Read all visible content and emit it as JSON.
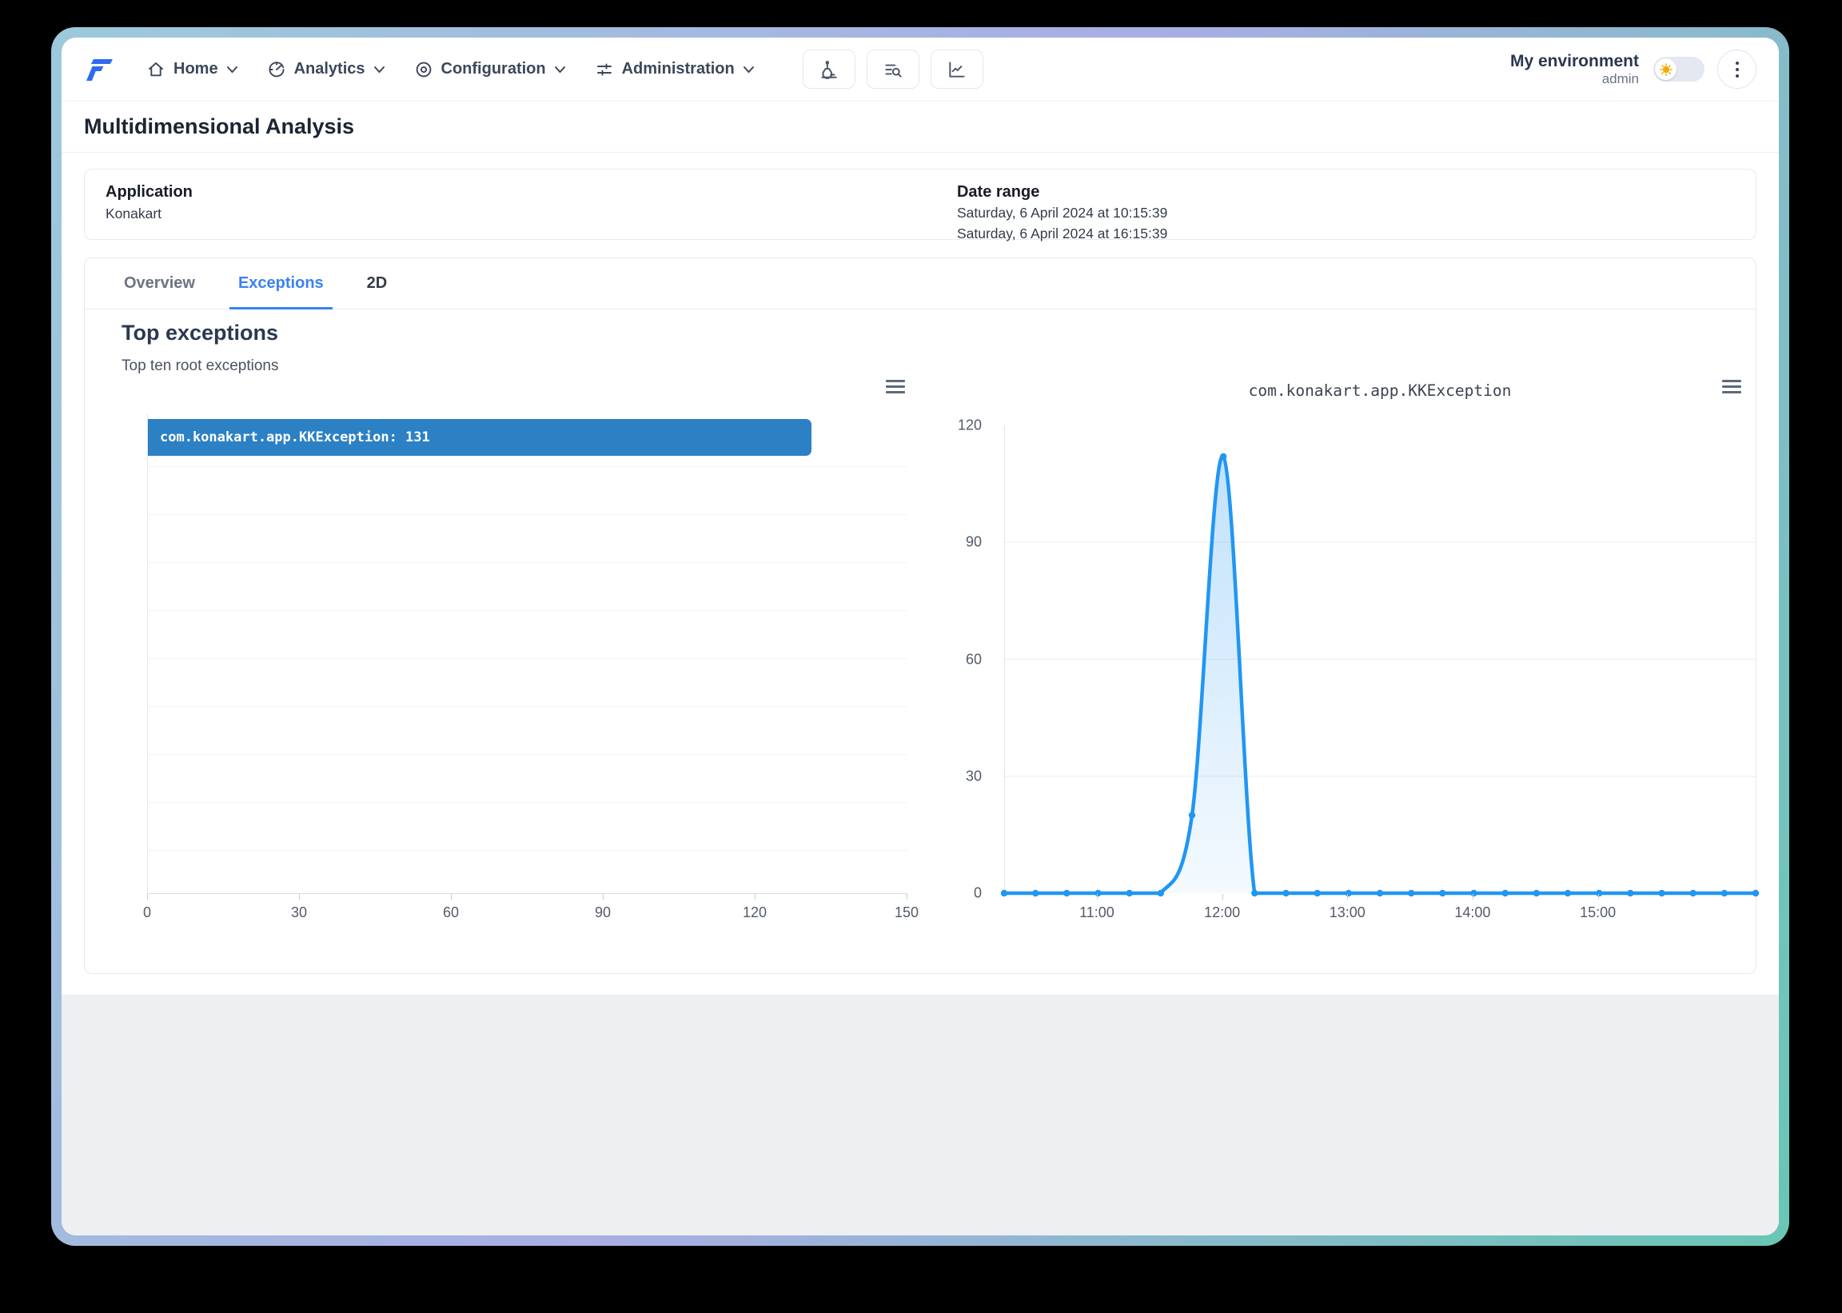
{
  "theme": {
    "accent": "#3b82f6",
    "window_border_top_left": "#9cc9db",
    "window_border_top_right": "#a9aee3",
    "window_border_bottom": "#69c6b5"
  },
  "nav": {
    "items": [
      {
        "label": "Home",
        "icon": "home-icon"
      },
      {
        "label": "Analytics",
        "icon": "analytics-icon"
      },
      {
        "label": "Configuration",
        "icon": "configuration-icon"
      },
      {
        "label": "Administration",
        "icon": "administration-icon"
      }
    ],
    "tools": [
      {
        "icon": "microscope-icon"
      },
      {
        "icon": "list-search-icon"
      },
      {
        "icon": "chart-line-icon"
      }
    ]
  },
  "environment": {
    "name": "My environment",
    "user": "admin"
  },
  "page": {
    "title": "Multidimensional Analysis",
    "filters": {
      "application_label": "Application",
      "application_value": "Konakart",
      "date_range_label": "Date range",
      "date_from": "Saturday, 6 April 2024 at 10:15:39",
      "date_to": "Saturday, 6 April 2024 at 16:15:39"
    },
    "tabs": [
      {
        "label": "Overview"
      },
      {
        "label": "Exceptions"
      },
      {
        "label": "2D"
      }
    ],
    "active_tab": "Exceptions"
  },
  "section": {
    "title": "Top exceptions",
    "subtitle": "Top ten root exceptions"
  },
  "chart_data": [
    {
      "type": "bar",
      "orientation": "horizontal",
      "title": "Top exceptions",
      "categories": [
        "com.konakart.app.KKException"
      ],
      "values": [
        131
      ],
      "bar_label": "com.konakart.app.KKException: 131",
      "xlim": [
        0,
        150
      ],
      "xticks": [
        0,
        30,
        60,
        90,
        120,
        150
      ],
      "rows": 10,
      "bar_color": "#2c80c4",
      "grid": true
    },
    {
      "type": "area",
      "title": "com.konakart.app.KKException",
      "x_start": "10:15:39",
      "x_end": "16:15:39",
      "duration_minutes": 360,
      "ylim": [
        0,
        120
      ],
      "y_ticks": [
        0,
        30,
        60,
        90,
        120
      ],
      "x_ticks": [
        {
          "label": "11:00",
          "minute": 44.4
        },
        {
          "label": "12:00",
          "minute": 104.4
        },
        {
          "label": "13:00",
          "minute": 164.4
        },
        {
          "label": "14:00",
          "minute": 224.4
        },
        {
          "label": "15:00",
          "minute": 284.4
        }
      ],
      "line_color": "#2196f3",
      "fill": "gradient",
      "marker": "dot",
      "points": [
        {
          "minute": 0,
          "value": 0
        },
        {
          "minute": 15,
          "value": 0
        },
        {
          "minute": 30,
          "value": 0
        },
        {
          "minute": 45,
          "value": 0
        },
        {
          "minute": 60,
          "value": 0
        },
        {
          "minute": 75,
          "value": 0
        },
        {
          "minute": 90,
          "value": 20
        },
        {
          "minute": 105,
          "value": 112
        },
        {
          "minute": 120,
          "value": 0
        },
        {
          "minute": 135,
          "value": 0
        },
        {
          "minute": 150,
          "value": 0
        },
        {
          "minute": 165,
          "value": 0
        },
        {
          "minute": 180,
          "value": 0
        },
        {
          "minute": 195,
          "value": 0
        },
        {
          "minute": 210,
          "value": 0
        },
        {
          "minute": 225,
          "value": 0
        },
        {
          "minute": 240,
          "value": 0
        },
        {
          "minute": 255,
          "value": 0
        },
        {
          "minute": 270,
          "value": 0
        },
        {
          "minute": 285,
          "value": 0
        },
        {
          "minute": 300,
          "value": 0
        },
        {
          "minute": 315,
          "value": 0
        },
        {
          "minute": 330,
          "value": 0
        },
        {
          "minute": 345,
          "value": 0
        },
        {
          "minute": 360,
          "value": 0
        }
      ]
    }
  ]
}
